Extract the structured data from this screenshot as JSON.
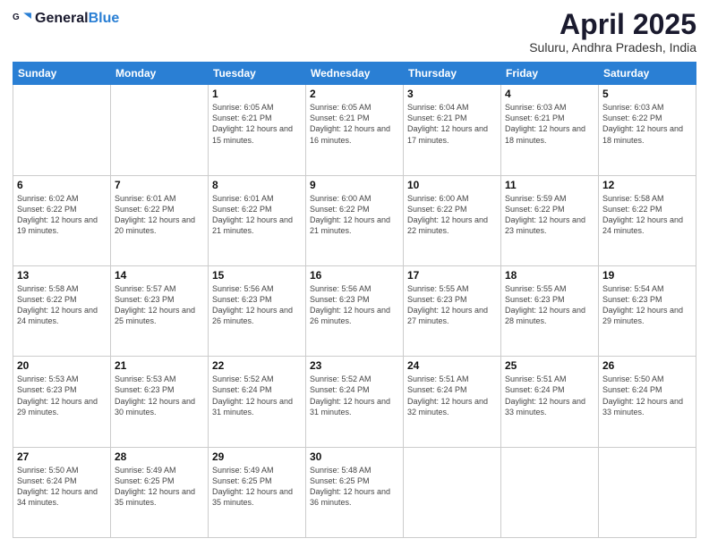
{
  "header": {
    "logo": {
      "general": "General",
      "blue": "Blue"
    },
    "title": "April 2025",
    "subtitle": "Suluru, Andhra Pradesh, India"
  },
  "calendar": {
    "days": [
      "Sunday",
      "Monday",
      "Tuesday",
      "Wednesday",
      "Thursday",
      "Friday",
      "Saturday"
    ],
    "weeks": [
      [
        {
          "day": "",
          "content": ""
        },
        {
          "day": "",
          "content": ""
        },
        {
          "day": "1",
          "content": "Sunrise: 6:05 AM\nSunset: 6:21 PM\nDaylight: 12 hours and 15 minutes."
        },
        {
          "day": "2",
          "content": "Sunrise: 6:05 AM\nSunset: 6:21 PM\nDaylight: 12 hours and 16 minutes."
        },
        {
          "day": "3",
          "content": "Sunrise: 6:04 AM\nSunset: 6:21 PM\nDaylight: 12 hours and 17 minutes."
        },
        {
          "day": "4",
          "content": "Sunrise: 6:03 AM\nSunset: 6:21 PM\nDaylight: 12 hours and 18 minutes."
        },
        {
          "day": "5",
          "content": "Sunrise: 6:03 AM\nSunset: 6:22 PM\nDaylight: 12 hours and 18 minutes."
        }
      ],
      [
        {
          "day": "6",
          "content": "Sunrise: 6:02 AM\nSunset: 6:22 PM\nDaylight: 12 hours and 19 minutes."
        },
        {
          "day": "7",
          "content": "Sunrise: 6:01 AM\nSunset: 6:22 PM\nDaylight: 12 hours and 20 minutes."
        },
        {
          "day": "8",
          "content": "Sunrise: 6:01 AM\nSunset: 6:22 PM\nDaylight: 12 hours and 21 minutes."
        },
        {
          "day": "9",
          "content": "Sunrise: 6:00 AM\nSunset: 6:22 PM\nDaylight: 12 hours and 21 minutes."
        },
        {
          "day": "10",
          "content": "Sunrise: 6:00 AM\nSunset: 6:22 PM\nDaylight: 12 hours and 22 minutes."
        },
        {
          "day": "11",
          "content": "Sunrise: 5:59 AM\nSunset: 6:22 PM\nDaylight: 12 hours and 23 minutes."
        },
        {
          "day": "12",
          "content": "Sunrise: 5:58 AM\nSunset: 6:22 PM\nDaylight: 12 hours and 24 minutes."
        }
      ],
      [
        {
          "day": "13",
          "content": "Sunrise: 5:58 AM\nSunset: 6:22 PM\nDaylight: 12 hours and 24 minutes."
        },
        {
          "day": "14",
          "content": "Sunrise: 5:57 AM\nSunset: 6:23 PM\nDaylight: 12 hours and 25 minutes."
        },
        {
          "day": "15",
          "content": "Sunrise: 5:56 AM\nSunset: 6:23 PM\nDaylight: 12 hours and 26 minutes."
        },
        {
          "day": "16",
          "content": "Sunrise: 5:56 AM\nSunset: 6:23 PM\nDaylight: 12 hours and 26 minutes."
        },
        {
          "day": "17",
          "content": "Sunrise: 5:55 AM\nSunset: 6:23 PM\nDaylight: 12 hours and 27 minutes."
        },
        {
          "day": "18",
          "content": "Sunrise: 5:55 AM\nSunset: 6:23 PM\nDaylight: 12 hours and 28 minutes."
        },
        {
          "day": "19",
          "content": "Sunrise: 5:54 AM\nSunset: 6:23 PM\nDaylight: 12 hours and 29 minutes."
        }
      ],
      [
        {
          "day": "20",
          "content": "Sunrise: 5:53 AM\nSunset: 6:23 PM\nDaylight: 12 hours and 29 minutes."
        },
        {
          "day": "21",
          "content": "Sunrise: 5:53 AM\nSunset: 6:23 PM\nDaylight: 12 hours and 30 minutes."
        },
        {
          "day": "22",
          "content": "Sunrise: 5:52 AM\nSunset: 6:24 PM\nDaylight: 12 hours and 31 minutes."
        },
        {
          "day": "23",
          "content": "Sunrise: 5:52 AM\nSunset: 6:24 PM\nDaylight: 12 hours and 31 minutes."
        },
        {
          "day": "24",
          "content": "Sunrise: 5:51 AM\nSunset: 6:24 PM\nDaylight: 12 hours and 32 minutes."
        },
        {
          "day": "25",
          "content": "Sunrise: 5:51 AM\nSunset: 6:24 PM\nDaylight: 12 hours and 33 minutes."
        },
        {
          "day": "26",
          "content": "Sunrise: 5:50 AM\nSunset: 6:24 PM\nDaylight: 12 hours and 33 minutes."
        }
      ],
      [
        {
          "day": "27",
          "content": "Sunrise: 5:50 AM\nSunset: 6:24 PM\nDaylight: 12 hours and 34 minutes."
        },
        {
          "day": "28",
          "content": "Sunrise: 5:49 AM\nSunset: 6:25 PM\nDaylight: 12 hours and 35 minutes."
        },
        {
          "day": "29",
          "content": "Sunrise: 5:49 AM\nSunset: 6:25 PM\nDaylight: 12 hours and 35 minutes."
        },
        {
          "day": "30",
          "content": "Sunrise: 5:48 AM\nSunset: 6:25 PM\nDaylight: 12 hours and 36 minutes."
        },
        {
          "day": "",
          "content": ""
        },
        {
          "day": "",
          "content": ""
        },
        {
          "day": "",
          "content": ""
        }
      ]
    ]
  }
}
